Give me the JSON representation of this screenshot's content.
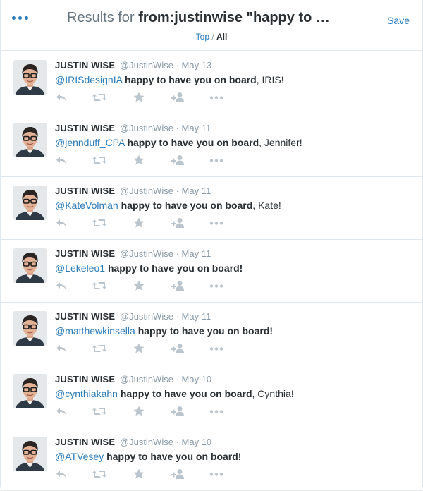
{
  "header": {
    "title_prefix": "Results for ",
    "title_query": "from:justinwise \"happy to …",
    "save_label": "Save",
    "filter_top": "Top",
    "filter_sep": " / ",
    "filter_all": "All"
  },
  "colors": {
    "accent": "#2b7bb9",
    "text": "#292f33",
    "muted": "#8899a6",
    "action_icon": "#bbc5cd",
    "divider": "#e1e8ed"
  },
  "icons": [
    "more-icon",
    "reply-icon",
    "retweet-icon",
    "favorite-icon",
    "follow-icon",
    "more-actions-icon"
  ],
  "tweets": [
    {
      "name": "JUSTIN WISE",
      "handle": "@JustinWise",
      "sep": "·",
      "date": "May 13",
      "mention": "@IRISdesignIA",
      "bold": "happy to have you on board",
      "tail": ", IRIS!"
    },
    {
      "name": "JUSTIN WISE",
      "handle": "@JustinWise",
      "sep": "·",
      "date": "May 11",
      "mention": "@jennduff_CPA",
      "bold": "happy to have you on board",
      "tail": ", Jennifer!"
    },
    {
      "name": "JUSTIN WISE",
      "handle": "@JustinWise",
      "sep": "·",
      "date": "May 11",
      "mention": "@KateVolman",
      "bold": "happy to have you on board",
      "tail": ", Kate!"
    },
    {
      "name": "JUSTIN WISE",
      "handle": "@JustinWise",
      "sep": "·",
      "date": "May 11",
      "mention": "@Lekeleo1",
      "bold": "happy to have you on board!",
      "tail": ""
    },
    {
      "name": "JUSTIN WISE",
      "handle": "@JustinWise",
      "sep": "·",
      "date": "May 11",
      "mention": "@matthewkinsella",
      "bold": "happy to have you on board!",
      "tail": ""
    },
    {
      "name": "JUSTIN WISE",
      "handle": "@JustinWise",
      "sep": "·",
      "date": "May 10",
      "mention": "@cynthiakahn",
      "bold": "happy to have you on board",
      "tail": ", Cynthia!"
    },
    {
      "name": "JUSTIN WISE",
      "handle": "@JustinWise",
      "sep": "·",
      "date": "May 10",
      "mention": "@ATVesey",
      "bold": "happy to have you on board!",
      "tail": ""
    }
  ]
}
